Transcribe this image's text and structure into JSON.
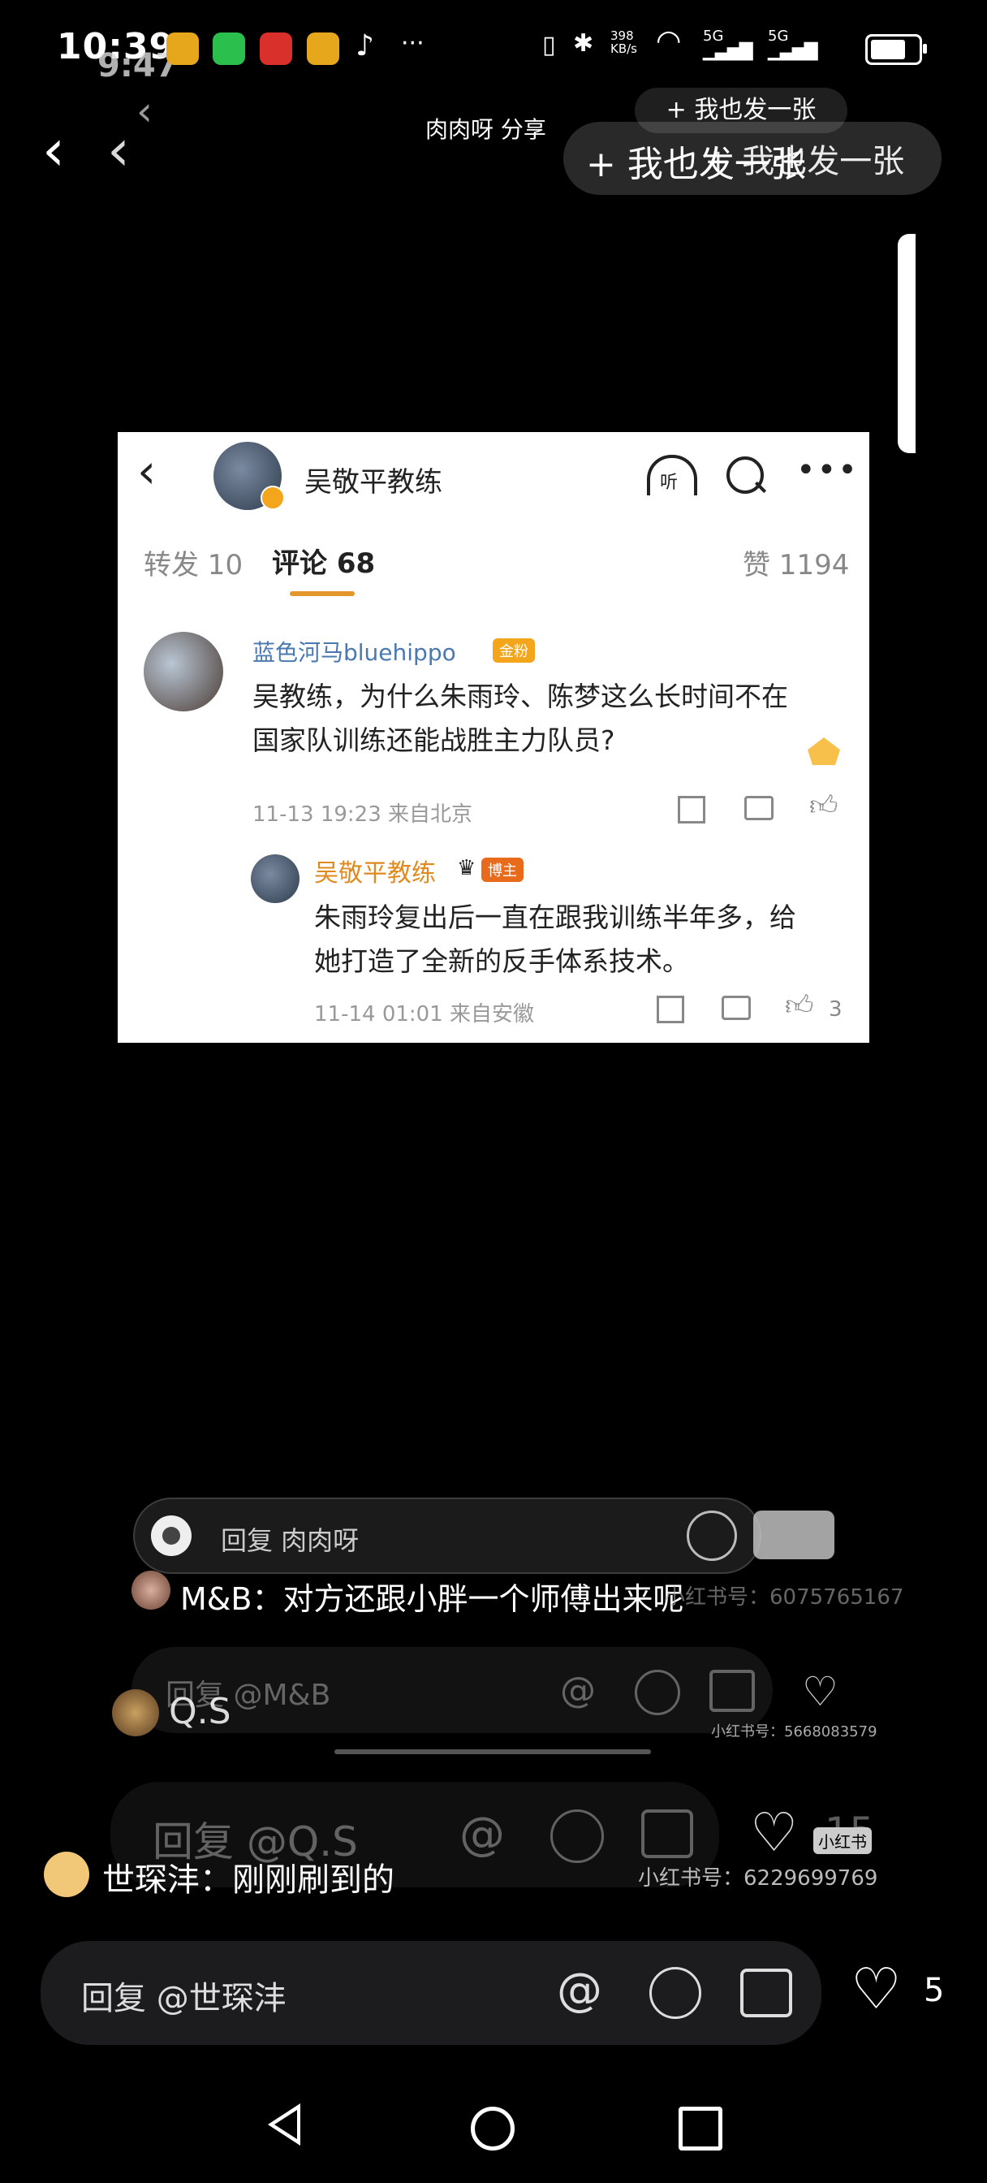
{
  "status": {
    "time": "10:39",
    "time_overlay": "9:47",
    "network_speed": "398 KB/s",
    "network_type_1": "5G",
    "network_type_2": "5G",
    "battery": "88"
  },
  "header": {
    "share_title": "肉肉呀 分享",
    "post_also_small": "+ 我也发一张",
    "post_also_large": "+ 我也发一张",
    "post_also_overlap": "+ 我也发一张"
  },
  "card": {
    "account_name": "吴敬平教练",
    "listen_label": "听",
    "tabs": {
      "forward": "转发 10",
      "comment": "评论 68",
      "likes": "赞 1194"
    },
    "comment": {
      "username": "蓝色河马bluehippo",
      "badge": "金粉",
      "text_line1": "吴教练，为什么朱雨玲、陈梦这么长时间不在",
      "text_line2": "国家队训练还能战胜主力队员?",
      "meta": "11-13 19:23  来自北京"
    },
    "reply": {
      "username": "吴敬平教练",
      "badge": "博主",
      "text_line1": "朱雨玲复出后一直在跟我训练半年多，给",
      "text_line2": "她打造了全新的反手体系技术。",
      "meta": "11-14 01:01  来自安徽",
      "like_count": "3"
    }
  },
  "overlay_comments": {
    "reply_rourou": "回复 肉肉呀",
    "mb_comment": "M&B：对方还跟小胖一个师傅出来呢",
    "xhs_id_1": "小红书号：6075765167",
    "reply_mb": "回复 @M&B",
    "qs_name": "Q.S",
    "xhs_id_2": "小红书号：5668083579",
    "reply_qs": "回复 @Q.S",
    "qs_like_count": "15",
    "shi_comment": "世琛沣：刚刚刷到的",
    "xhs_id_3": "小红书号：6229699769",
    "reply_shi": "回复 @世琛沣",
    "like_count": "5",
    "xhs_watermark": "小红书"
  },
  "icons": {
    "back": "chevron-left-icon",
    "headphones": "headphones-icon",
    "search": "search-icon",
    "more": "more-icon",
    "camera": "camera-icon",
    "at": "at-icon",
    "emoji": "emoji-icon",
    "image": "image-icon",
    "heart": "heart-icon",
    "nav_back": "triangle-back-icon",
    "nav_home": "circle-home-icon",
    "nav_recent": "square-recent-icon"
  },
  "colors": {
    "background": "#000000",
    "card_bg": "#ffffff",
    "accent_orange": "#f3a51b",
    "reply_name": "#e08a1e",
    "muted": "#999999"
  }
}
